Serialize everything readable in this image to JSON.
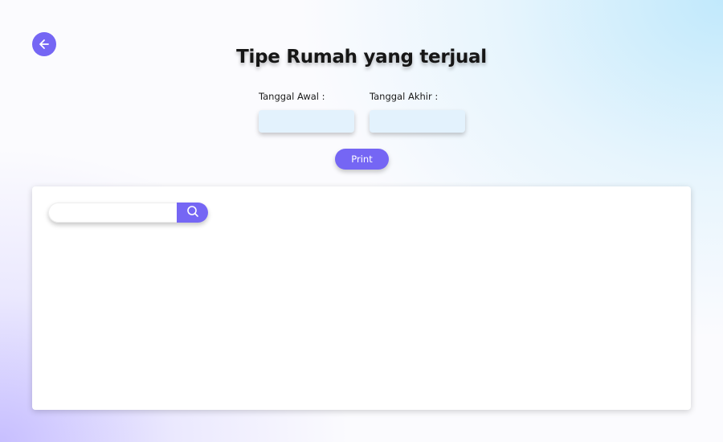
{
  "header": {
    "title": "Tipe Rumah yang terjual",
    "back_icon": "arrow-left-icon"
  },
  "filters": {
    "start_date": {
      "label": "Tanggal Awal :",
      "value": ""
    },
    "end_date": {
      "label": "Tanggal Akhir :",
      "value": ""
    },
    "print_label": "Print"
  },
  "table_panel": {
    "search": {
      "placeholder": "",
      "value": "",
      "icon": "search-icon"
    }
  },
  "colors": {
    "accent": "#7566f4",
    "input_background": "#e3f2fd",
    "title_text": "#161616"
  }
}
